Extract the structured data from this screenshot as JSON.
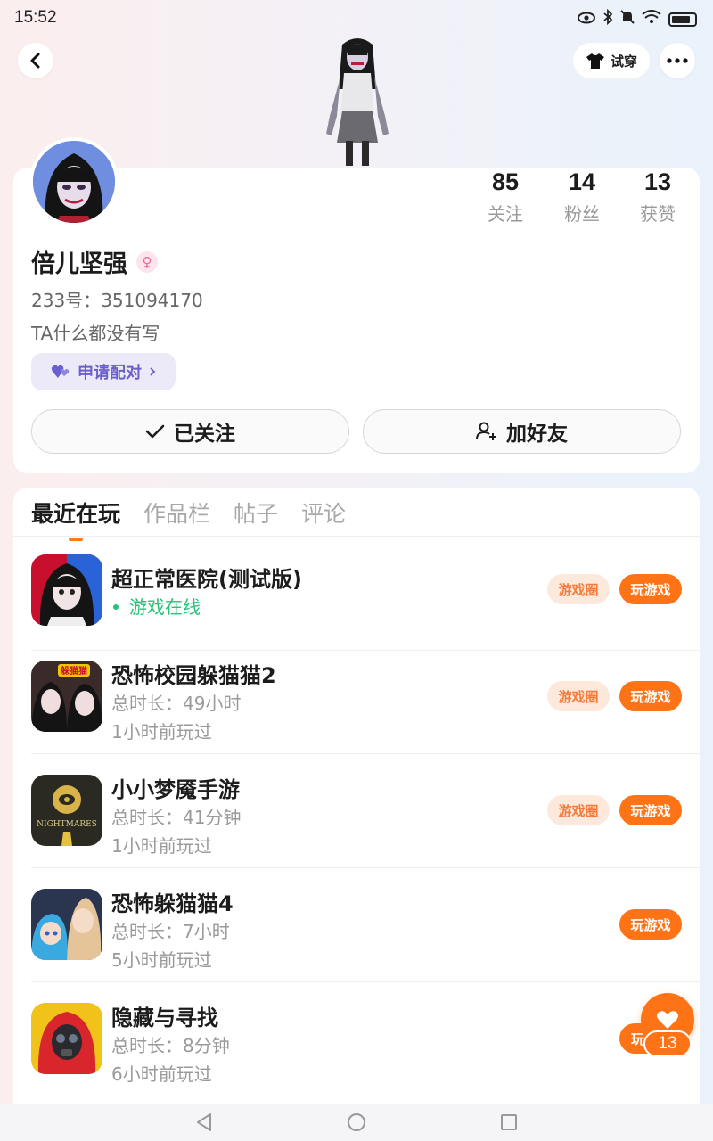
{
  "status_bar": {
    "time": "15:52",
    "icons": [
      "eye-icon",
      "bluetooth-icon",
      "mute-icon",
      "wifi-icon",
      "battery-icon"
    ]
  },
  "header": {
    "try_on_label": "试穿"
  },
  "profile": {
    "stats": [
      {
        "value": "85",
        "label": "关注"
      },
      {
        "value": "14",
        "label": "粉丝"
      },
      {
        "value": "13",
        "label": "获赞"
      }
    ],
    "name": "倍儿坚强",
    "gender": "female",
    "uid_label": "233号：",
    "uid": "351094170",
    "bio": "TA什么都没有写",
    "match_label": "申请配对",
    "follow_label": "已关注",
    "add_friend_label": "加好友"
  },
  "tabs": [
    {
      "label": "最近在玩",
      "active": true
    },
    {
      "label": "作品栏",
      "active": false
    },
    {
      "label": "帖子",
      "active": false
    },
    {
      "label": "评论",
      "active": false
    }
  ],
  "games": [
    {
      "title": "超正常医院(测试版)",
      "status": "游戏在线",
      "circle_label": "游戏圈",
      "play_label": "玩游戏"
    },
    {
      "title": "恐怖校园躲猫猫2",
      "duration": "总时长：49小时",
      "last_played": "1小时前玩过",
      "circle_label": "游戏圈",
      "play_label": "玩游戏"
    },
    {
      "title": "小小梦魇手游",
      "duration": "总时长：41分钟",
      "last_played": "1小时前玩过",
      "circle_label": "游戏圈",
      "play_label": "玩游戏"
    },
    {
      "title": "恐怖躲猫猫4",
      "duration": "总时长：7小时",
      "last_played": "5小时前玩过",
      "play_label": "玩游戏"
    },
    {
      "title": "隐藏与寻找",
      "duration": "总时长：8分钟",
      "last_played": "6小时前玩过",
      "play_label": "玩"
    }
  ],
  "fab": {
    "count": "13"
  },
  "colors": {
    "accent": "#ff7317",
    "online": "#27c27a",
    "match": "#6b5fce"
  }
}
